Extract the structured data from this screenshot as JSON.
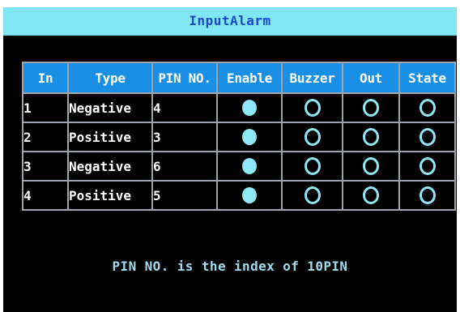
{
  "window": {
    "title": "InputAlarm"
  },
  "table": {
    "headers": [
      "In",
      "Type",
      "PIN NO.",
      "Enable",
      "Buzzer",
      "Out",
      "State"
    ],
    "rows": [
      {
        "in": "1",
        "type": "Negative",
        "pin": "4",
        "enable": "on",
        "buzzer": "off",
        "out": "off",
        "state": "off"
      },
      {
        "in": "2",
        "type": "Positive",
        "pin": "3",
        "enable": "on",
        "buzzer": "off",
        "out": "off",
        "state": "off"
      },
      {
        "in": "3",
        "type": "Negative",
        "pin": "6",
        "enable": "on",
        "buzzer": "off",
        "out": "off",
        "state": "off"
      },
      {
        "in": "4",
        "type": "Positive",
        "pin": "5",
        "enable": "on",
        "buzzer": "off",
        "out": "off",
        "state": "off"
      }
    ]
  },
  "footer": {
    "note": "PIN NO. is the index of 10PIN"
  },
  "colors": {
    "title_bar": "#7fe6f2",
    "title_text": "#1f47c8",
    "header_bg": "#1a8fe6",
    "grid": "#9ea3ae",
    "indicator": "#8fe8f5",
    "background": "#000000"
  },
  "icons": {
    "enabled": "filled-circle-icon",
    "disabled": "hollow-circle-icon"
  }
}
